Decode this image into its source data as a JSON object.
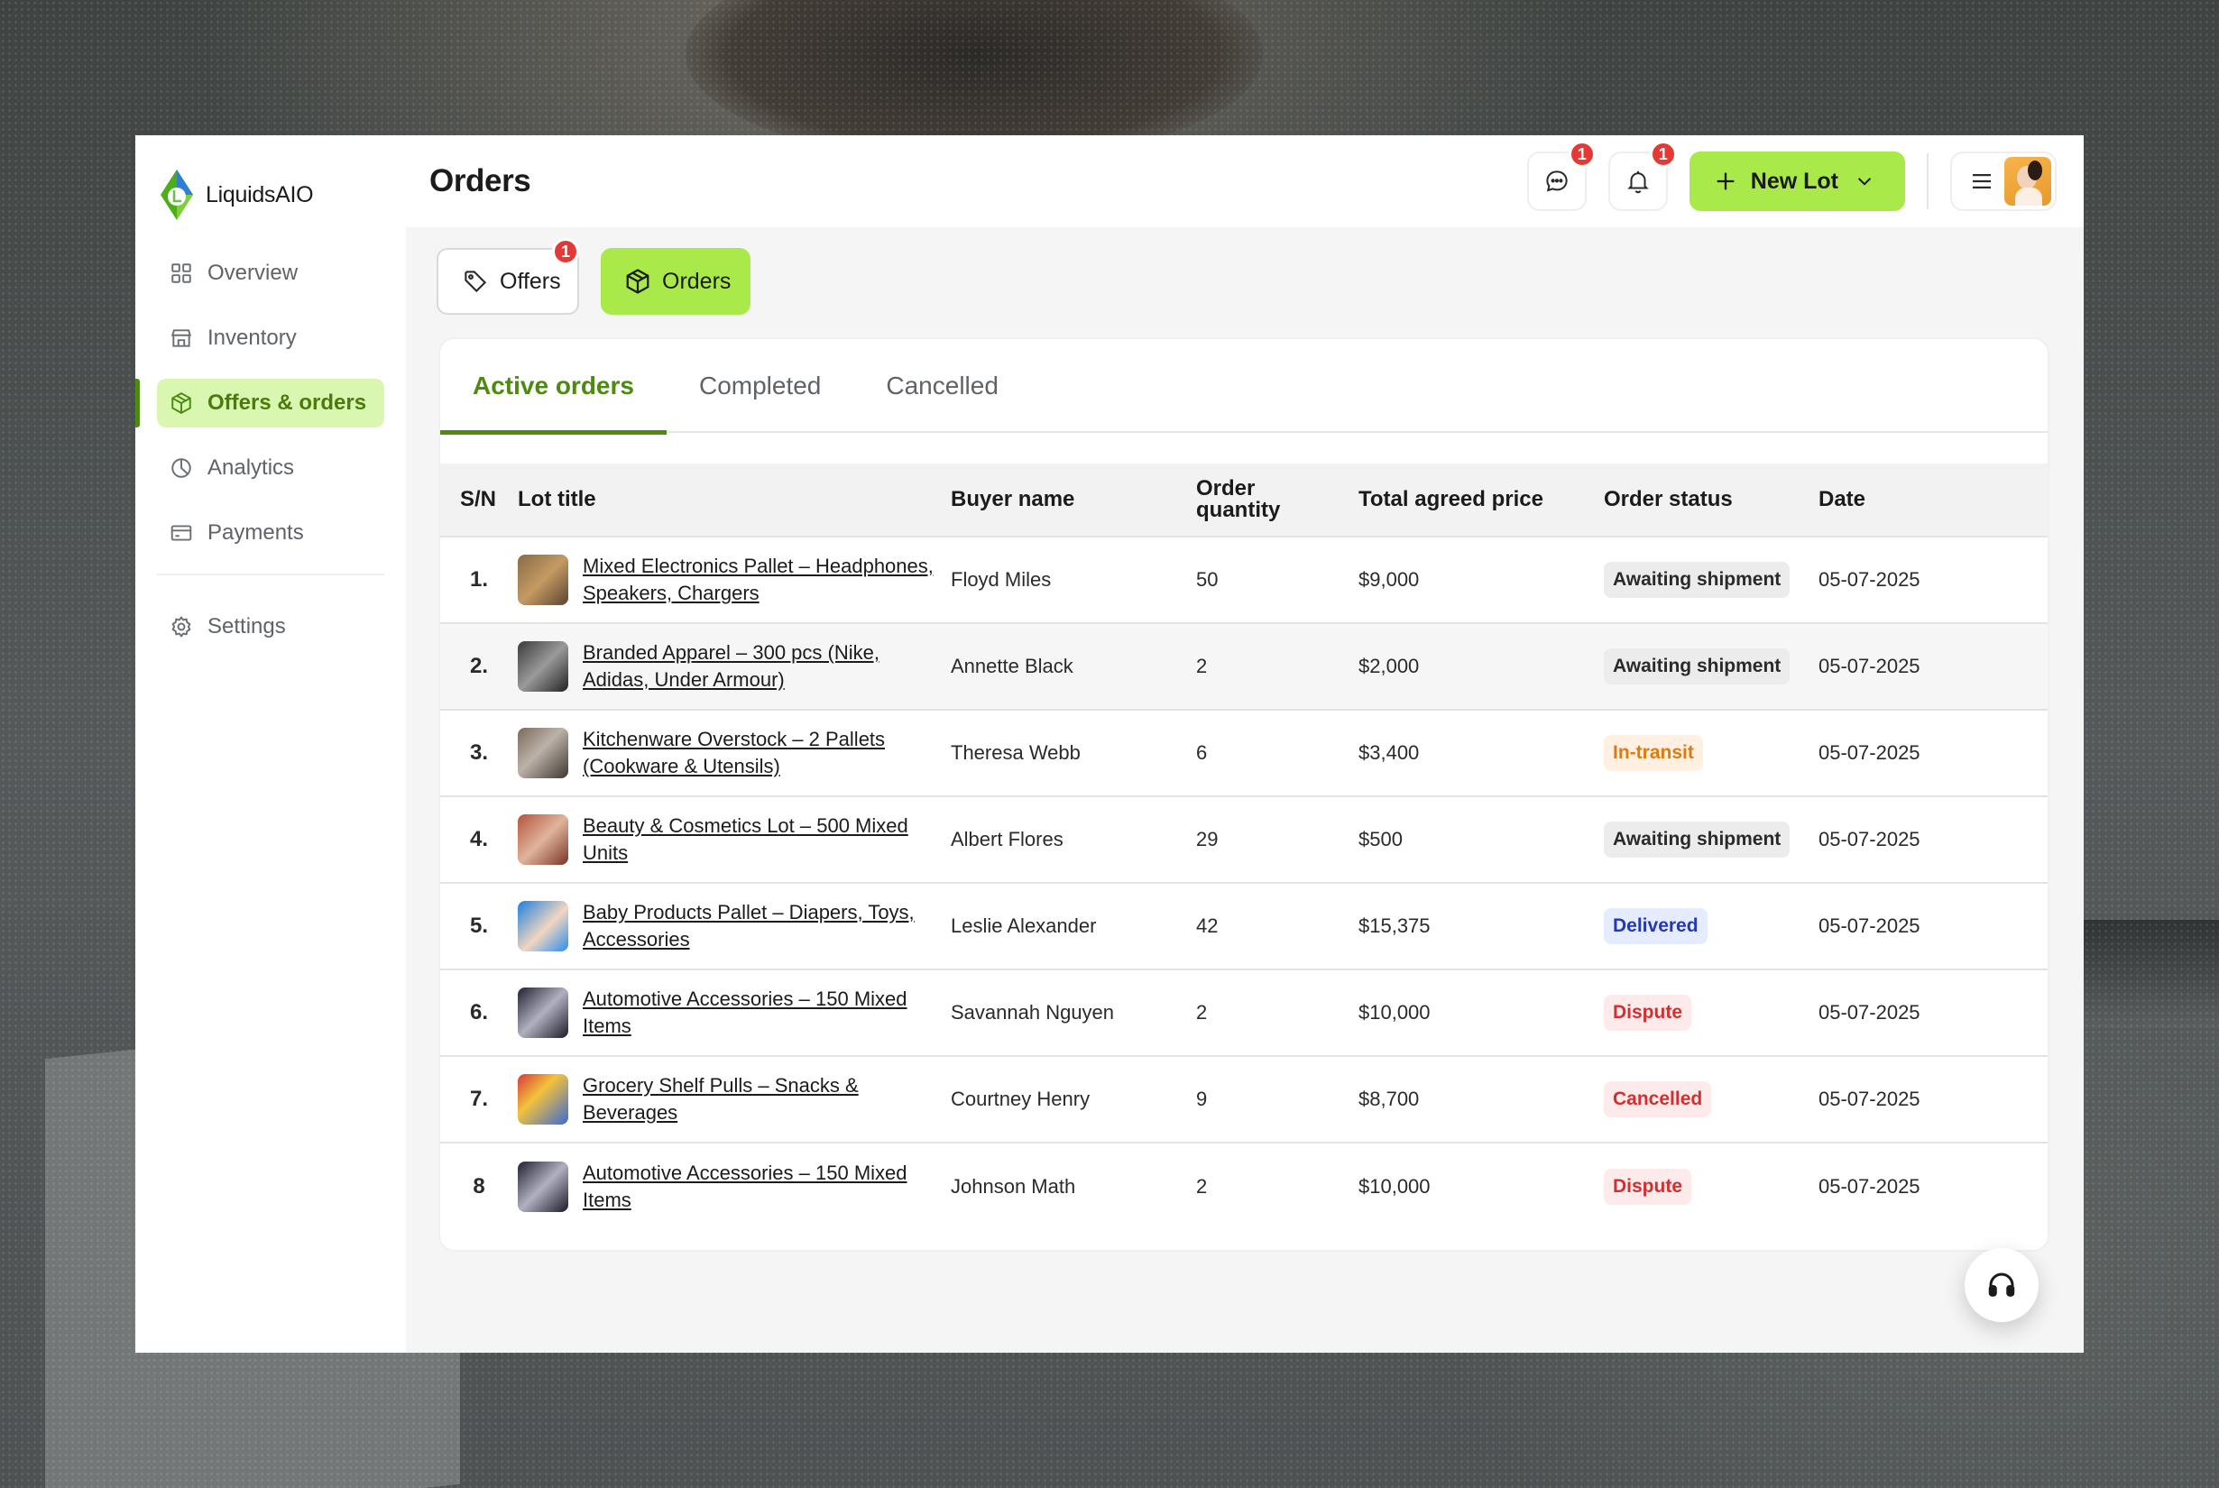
{
  "app": {
    "name": "LiquidsAIO"
  },
  "sidebar": {
    "items": [
      {
        "label": "Overview",
        "icon": "grid-icon",
        "active": false
      },
      {
        "label": "Inventory",
        "icon": "store-icon",
        "active": false
      },
      {
        "label": "Offers & orders",
        "icon": "box-icon",
        "active": true
      },
      {
        "label": "Analytics",
        "icon": "pie-chart-icon",
        "active": false
      },
      {
        "label": "Payments",
        "icon": "card-icon",
        "active": false
      }
    ],
    "settings": {
      "label": "Settings",
      "icon": "gear-icon"
    }
  },
  "header": {
    "title": "Orders",
    "messages_badge": "1",
    "notifications_badge": "1",
    "new_lot_label": "New Lot"
  },
  "segments": {
    "offers_label": "Offers",
    "offers_badge": "1",
    "orders_label": "Orders"
  },
  "tabs": [
    {
      "label": "Active orders",
      "active": true
    },
    {
      "label": "Completed",
      "active": false
    },
    {
      "label": "Cancelled",
      "active": false
    }
  ],
  "table": {
    "headers": {
      "sn": "S/N",
      "lot": "Lot title",
      "buyer": "Buyer name",
      "qty": "Order quantity",
      "price": "Total agreed price",
      "status": "Order status",
      "date": "Date"
    },
    "rows": [
      {
        "sn": "1.",
        "lot": "Mixed Electronics Pallet – Headphones, Speakers, Chargers",
        "buyer": "Floyd Miles",
        "qty": "50",
        "price": "$9,000",
        "status": "Awaiting shipment",
        "status_kind": "await",
        "date": "05-07-2025"
      },
      {
        "sn": "2.",
        "lot": "Branded Apparel – 300 pcs (Nike, Adidas, Under Armour)",
        "buyer": "Annette Black",
        "qty": "2",
        "price": "$2,000",
        "status": "Awaiting shipment",
        "status_kind": "await",
        "date": "05-07-2025"
      },
      {
        "sn": "3.",
        "lot": "Kitchenware Overstock – 2 Pallets (Cookware & Utensils)",
        "buyer": "Theresa Webb",
        "qty": "6",
        "price": "$3,400",
        "status": "In-transit",
        "status_kind": "transit",
        "date": "05-07-2025"
      },
      {
        "sn": "4.",
        "lot": "Beauty & Cosmetics Lot – 500 Mixed Units",
        "buyer": "Albert Flores",
        "qty": "29",
        "price": "$500",
        "status": "Awaiting shipment",
        "status_kind": "await",
        "date": "05-07-2025"
      },
      {
        "sn": "5.",
        "lot": "Baby Products Pallet – Diapers, Toys, Accessories",
        "buyer": "Leslie Alexander",
        "qty": "42",
        "price": "$15,375",
        "status": "Delivered",
        "status_kind": "delivered",
        "date": "05-07-2025"
      },
      {
        "sn": "6.",
        "lot": "Automotive Accessories – 150 Mixed Items",
        "buyer": "Savannah Nguyen",
        "qty": "2",
        "price": "$10,000",
        "status": "Dispute",
        "status_kind": "dispute",
        "date": "05-07-2025"
      },
      {
        "sn": "7.",
        "lot": "Grocery Shelf Pulls – Snacks & Beverages",
        "buyer": "Courtney Henry",
        "qty": "9",
        "price": "$8,700",
        "status": "Cancelled",
        "status_kind": "cancelled",
        "date": "05-07-2025"
      },
      {
        "sn": "8",
        "lot": "Automotive Accessories – 150 Mixed Items",
        "buyer": "Johnson Math",
        "qty": "2",
        "price": "$10,000",
        "status": "Dispute",
        "status_kind": "dispute",
        "date": "05-07-2025"
      }
    ]
  },
  "colors": {
    "accent": "#a9ea4a",
    "accent_dark": "#4c8a10",
    "badge": "#e53935"
  }
}
